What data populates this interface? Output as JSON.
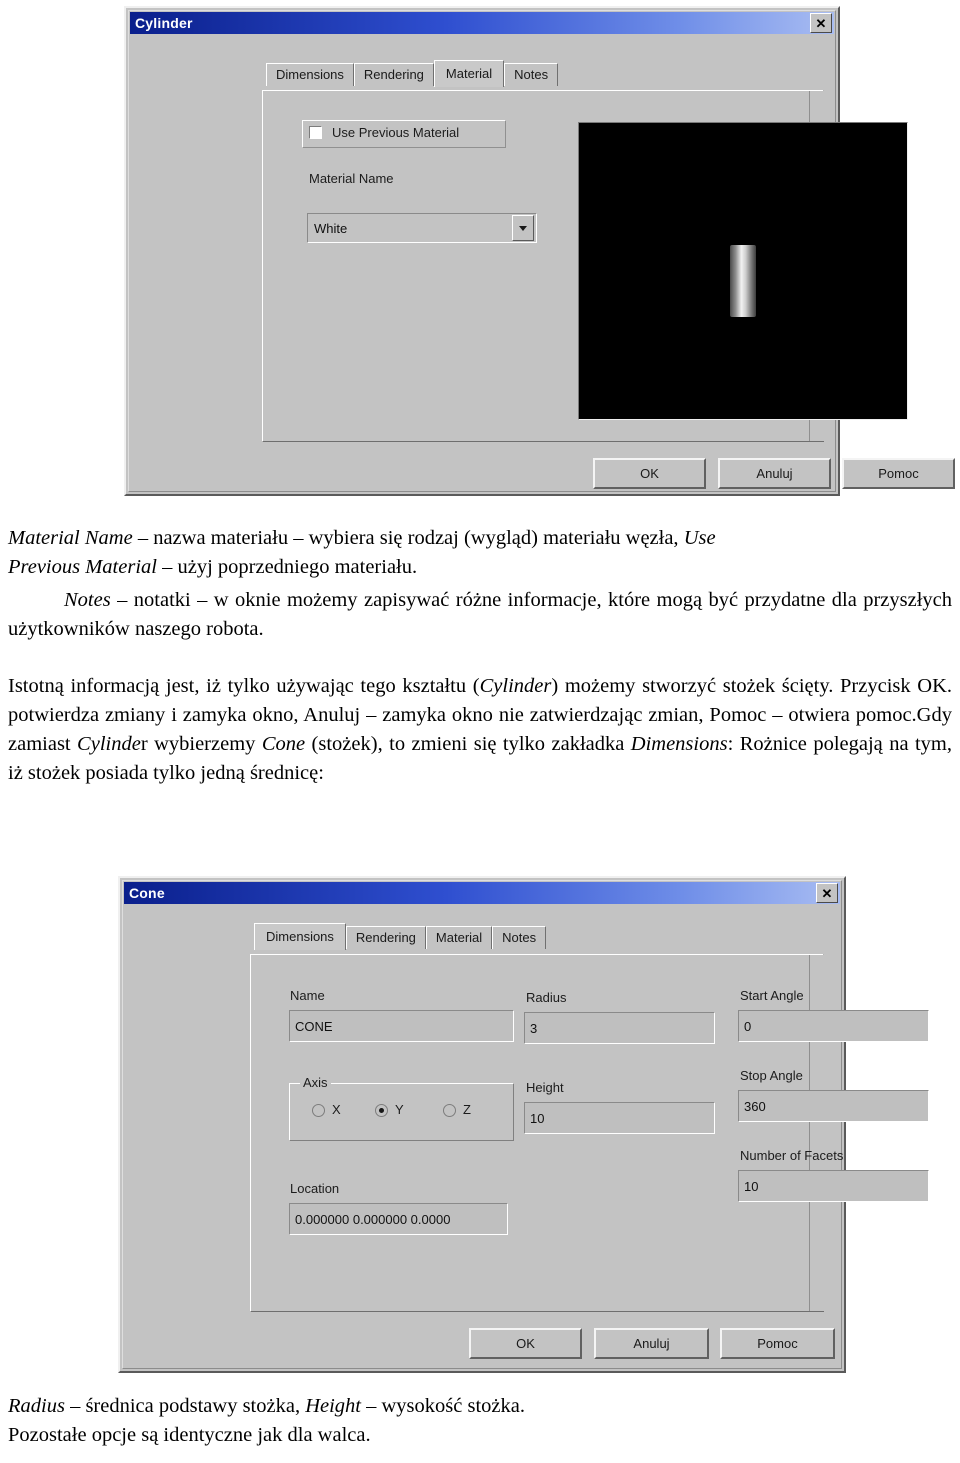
{
  "cylinder_dialog": {
    "title": "Cylinder",
    "close_label": "✕",
    "tabs": [
      {
        "label": "Dimensions",
        "active": false
      },
      {
        "label": "Rendering",
        "active": false
      },
      {
        "label": "Material",
        "active": true
      },
      {
        "label": "Notes",
        "active": false
      }
    ],
    "use_previous_material_label": "Use Previous Material",
    "material_name_label": "Material Name",
    "material_value": "White",
    "buttons": {
      "ok": "OK",
      "cancel": "Anuluj",
      "help": "Pomoc"
    }
  },
  "cone_dialog": {
    "title": "Cone",
    "close_label": "✕",
    "tabs": [
      {
        "label": "Dimensions",
        "active": true
      },
      {
        "label": "Rendering",
        "active": false
      },
      {
        "label": "Material",
        "active": false
      },
      {
        "label": "Notes",
        "active": false
      }
    ],
    "fields": {
      "name_label": "Name",
      "name_value": "CONE",
      "axis_label": "Axis",
      "axis_options": [
        "X",
        "Y",
        "Z"
      ],
      "axis_selected": "Y",
      "location_label": "Location",
      "location_value": "0.000000 0.000000 0.0000",
      "radius_label": "Radius",
      "radius_value": "3",
      "height_label": "Height",
      "height_value": "10",
      "start_angle_label": "Start Angle",
      "start_angle_value": "0",
      "stop_angle_label": "Stop Angle",
      "stop_angle_value": "360",
      "facets_label": "Number of Facets",
      "facets_value": "10"
    },
    "buttons": {
      "ok": "OK",
      "cancel": "Anuluj",
      "help": "Pomoc"
    }
  },
  "body_text": {
    "p1_line1_a": "Material Name",
    "p1_line1_b": " – nazwa materiału – wybiera się rodzaj (wygląd) materiału węzła, ",
    "p1_line1_c": "Use",
    "p1_line2_a": "Previous Material",
    "p1_line2_b": " – użyj poprzedniego materiału.",
    "p2_a": "Notes",
    "p2_b": " – notatki – w oknie możemy zapisywać różne informacje, które mogą być przydatne dla przyszłych użytkowników naszego robota.",
    "p3_a": "Istotną informacją jest, iż tylko używając tego kształtu (",
    "p3_b": "Cylinder",
    "p3_c": ") możemy stworzyć stożek ścięty. Przycisk OK. potwierdza zmiany i zamyka okno, Anuluj – zamyka okno nie zatwierdzając zmian, Pomoc – otwiera pomoc.Gdy zamiast ",
    "p3_d": "Cylinde",
    "p3_e": "r wybierzemy ",
    "p3_f": "Cone",
    "p3_g": " (stożek), to zmieni się tylko zakładka ",
    "p3_h": "Dimensions",
    "p3_i": ": Rożnice polegają na tym, iż stożek posiada tylko jedną średnicę:",
    "p4_a": "Radius",
    "p4_b": " – średnica podstawy stożka, ",
    "p4_c": "Height",
    "p4_d": " – wysokość stożka.",
    "p4_e": "Pozostałe opcje są identyczne jak dla walca."
  }
}
